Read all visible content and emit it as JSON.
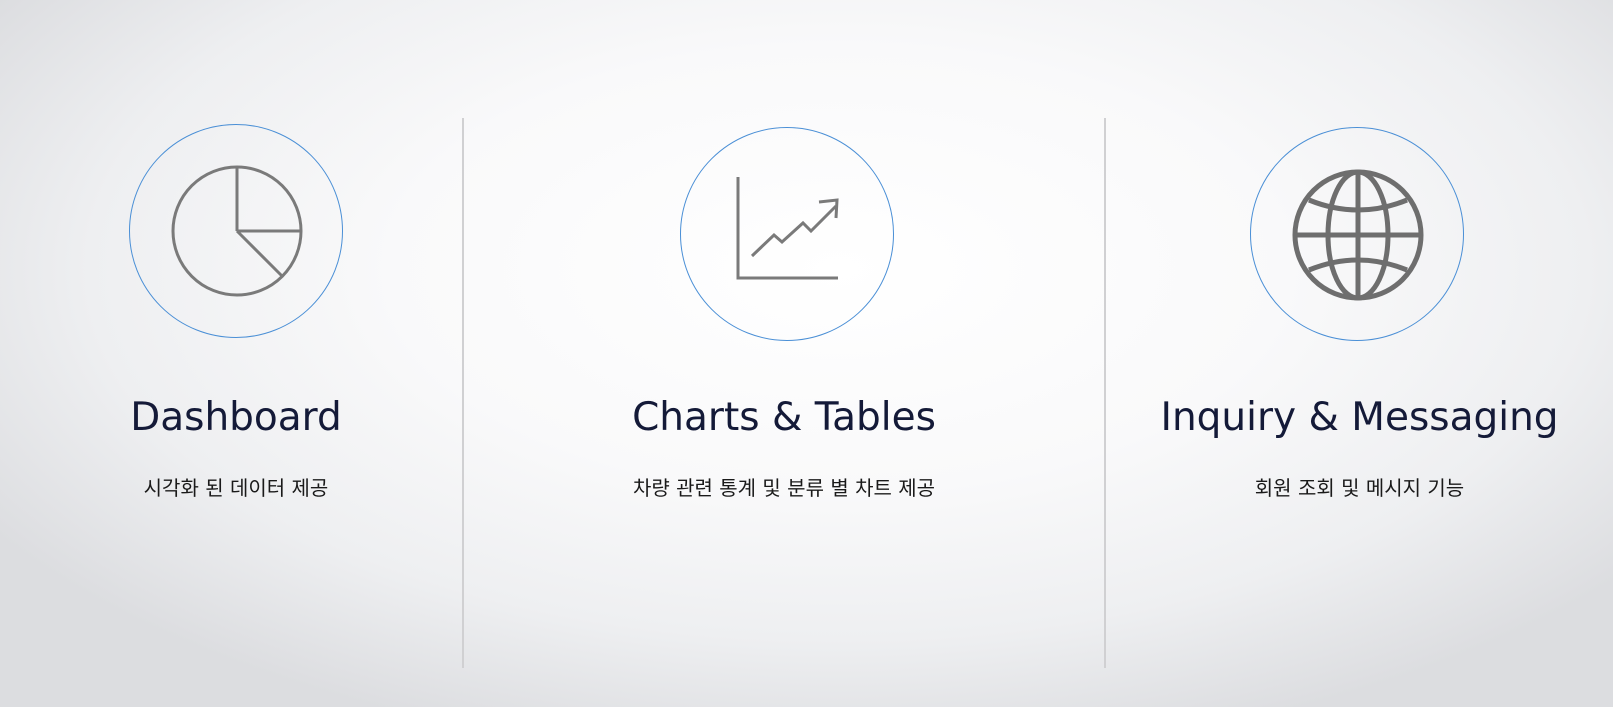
{
  "features": [
    {
      "title": "Dashboard",
      "description": "시각화 된 데이터 제공",
      "icon": "pie-chart-icon"
    },
    {
      "title": "Charts & Tables",
      "description": "차량 관련 통계 및 분류 별 차트 제공",
      "icon": "line-chart-icon"
    },
    {
      "title": "Inquiry & Messaging",
      "description": "회원 조회 및 메시지 기능",
      "icon": "globe-icon"
    }
  ],
  "colors": {
    "circle_border": "#4a8fd6",
    "icon_stroke": "#7a7a7a",
    "title_text": "#141a38",
    "divider": "#d0d0d2"
  }
}
